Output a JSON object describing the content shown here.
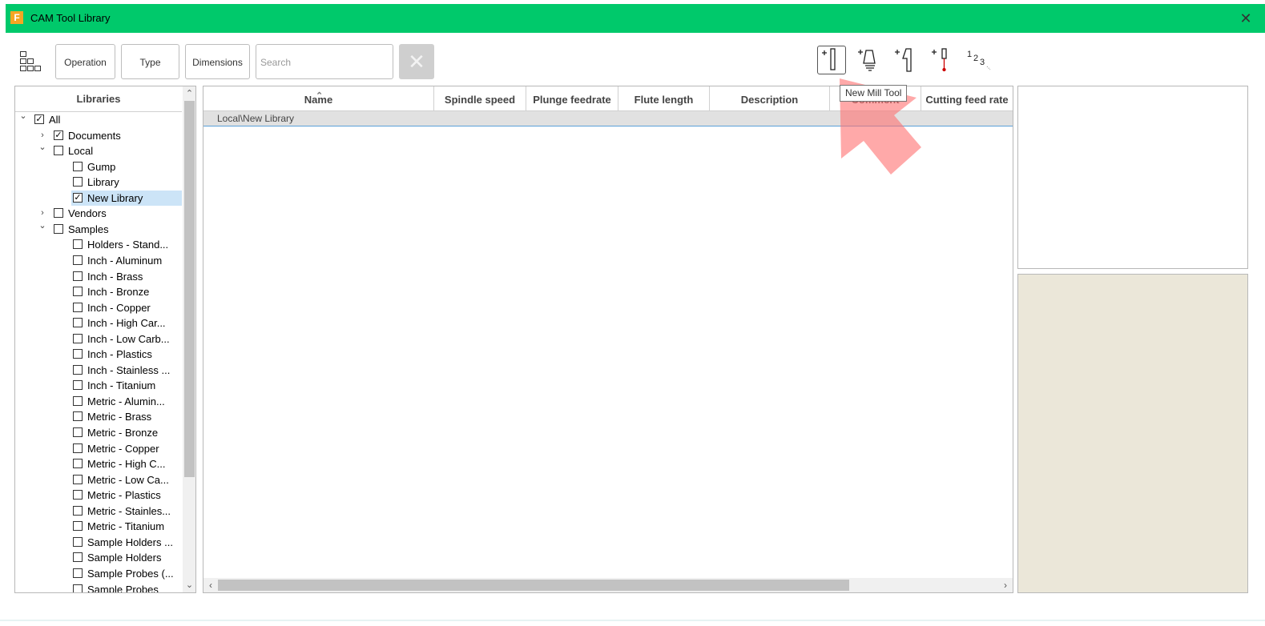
{
  "window": {
    "title": "CAM Tool Library",
    "app_icon_letter": "F",
    "close_glyph": "✕",
    "titlebar_color": "#00c96b"
  },
  "toolbar": {
    "layout_icon": "grid-layout-icon",
    "filters": [
      "Operation",
      "Type",
      "Dimensions"
    ],
    "search_placeholder": "Search",
    "clear_glyph": "✕",
    "tool_buttons": [
      "new-mill-tool-icon",
      "new-holder-icon",
      "new-turning-tool-icon",
      "new-probe-icon",
      "renumber-icon"
    ],
    "tooltip": "New Mill Tool"
  },
  "libraries": {
    "header": "Libraries",
    "items": [
      {
        "label": "All",
        "checked": true,
        "expanded": true,
        "level": 0
      },
      {
        "label": "Documents",
        "checked": true,
        "expanded": false,
        "level": 1
      },
      {
        "label": "Local",
        "checked": false,
        "expanded": true,
        "level": 1
      },
      {
        "label": "Gump",
        "checked": false,
        "level": 2
      },
      {
        "label": "Library",
        "checked": false,
        "level": 2
      },
      {
        "label": "New Library",
        "checked": true,
        "level": 2,
        "selected": true
      },
      {
        "label": "Vendors",
        "checked": false,
        "expanded": false,
        "level": 1
      },
      {
        "label": "Samples",
        "checked": false,
        "expanded": true,
        "level": 1
      },
      {
        "label": "Holders - Stand...",
        "checked": false,
        "level": 2
      },
      {
        "label": "Inch - Aluminum",
        "checked": false,
        "level": 2
      },
      {
        "label": "Inch - Brass",
        "checked": false,
        "level": 2
      },
      {
        "label": "Inch - Bronze",
        "checked": false,
        "level": 2
      },
      {
        "label": "Inch - Copper",
        "checked": false,
        "level": 2
      },
      {
        "label": "Inch - High Car...",
        "checked": false,
        "level": 2
      },
      {
        "label": "Inch - Low Carb...",
        "checked": false,
        "level": 2
      },
      {
        "label": "Inch - Plastics",
        "checked": false,
        "level": 2
      },
      {
        "label": "Inch - Stainless ...",
        "checked": false,
        "level": 2
      },
      {
        "label": "Inch - Titanium",
        "checked": false,
        "level": 2
      },
      {
        "label": "Metric - Alumin...",
        "checked": false,
        "level": 2
      },
      {
        "label": "Metric - Brass",
        "checked": false,
        "level": 2
      },
      {
        "label": "Metric - Bronze",
        "checked": false,
        "level": 2
      },
      {
        "label": "Metric - Copper",
        "checked": false,
        "level": 2
      },
      {
        "label": "Metric - High C...",
        "checked": false,
        "level": 2
      },
      {
        "label": "Metric - Low Ca...",
        "checked": false,
        "level": 2
      },
      {
        "label": "Metric - Plastics",
        "checked": false,
        "level": 2
      },
      {
        "label": "Metric - Stainles...",
        "checked": false,
        "level": 2
      },
      {
        "label": "Metric - Titanium",
        "checked": false,
        "level": 2
      },
      {
        "label": "Sample Holders ...",
        "checked": false,
        "level": 2
      },
      {
        "label": "Sample Holders",
        "checked": false,
        "level": 2
      },
      {
        "label": "Sample Probes (...",
        "checked": false,
        "level": 2
      },
      {
        "label": "Sample Probes",
        "checked": false,
        "level": 2
      }
    ]
  },
  "table": {
    "columns": [
      "Name",
      "Spindle speed",
      "Plunge feedrate",
      "Flute length",
      "Description",
      "Comment",
      "Cutting feed rate"
    ],
    "group_row": "Local\\New Library",
    "rows": []
  },
  "preview": {
    "bottom_color": "#ebe7d9"
  }
}
